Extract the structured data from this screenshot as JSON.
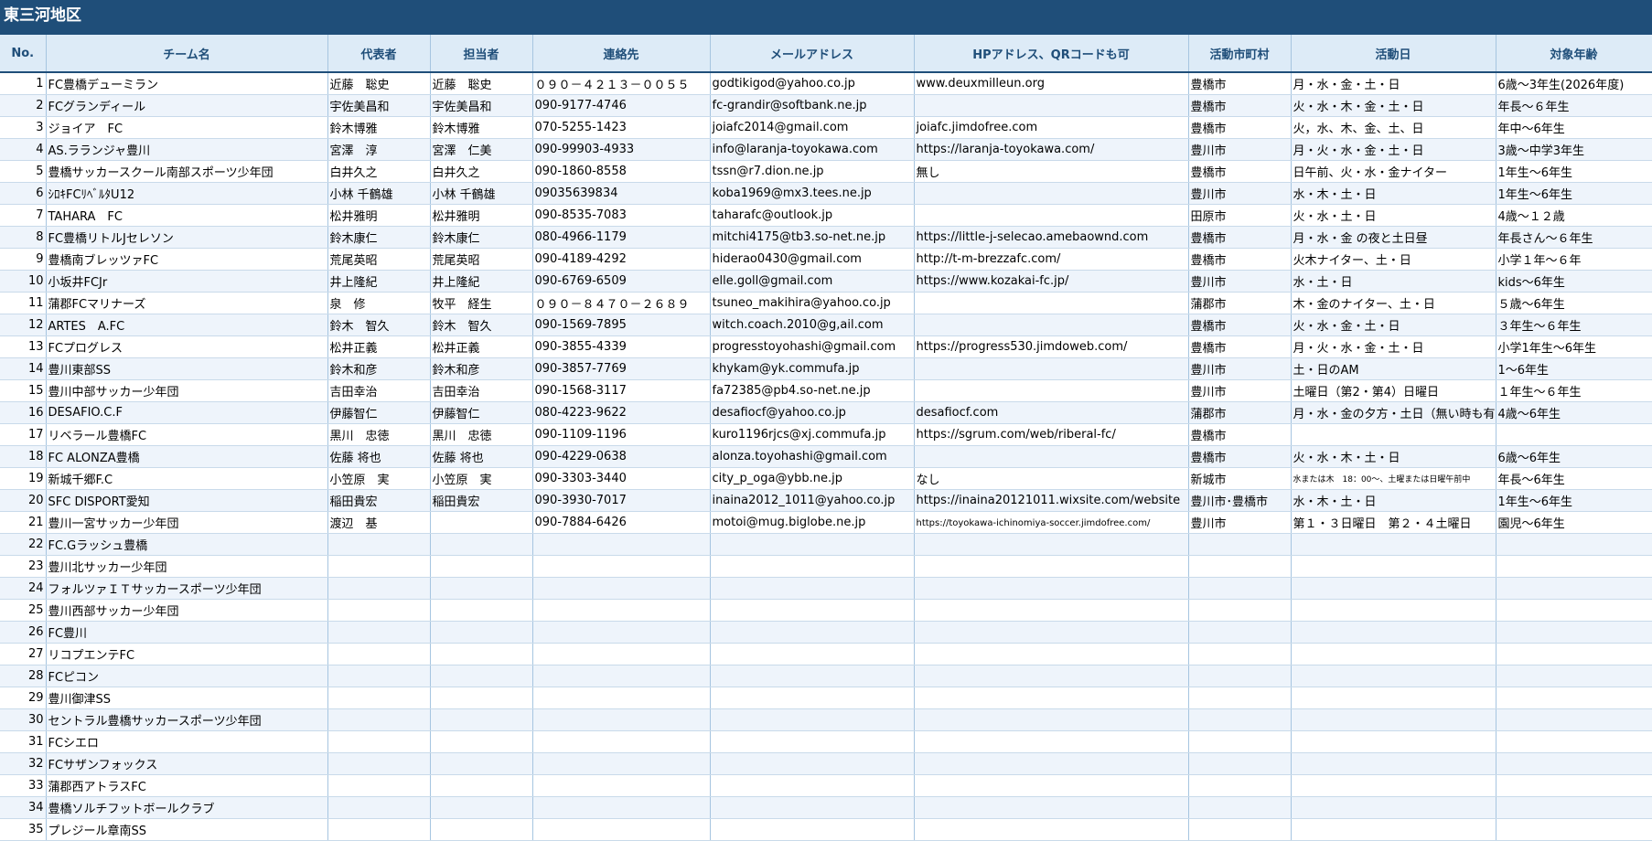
{
  "sheet_title": "東三河地区",
  "accent_color": "#1f4e79",
  "header_fill": "#ddebf7",
  "columns": [
    {
      "key": "no",
      "label": "No."
    },
    {
      "key": "team",
      "label": "チーム名"
    },
    {
      "key": "rep",
      "label": "代表者"
    },
    {
      "key": "contact_person",
      "label": "担当者"
    },
    {
      "key": "phone",
      "label": "連絡先"
    },
    {
      "key": "email",
      "label": "メールアドレス"
    },
    {
      "key": "hp",
      "label": "HPアドレス、QRコードも可"
    },
    {
      "key": "city",
      "label": "活動市町村"
    },
    {
      "key": "days",
      "label": "活動日"
    },
    {
      "key": "age",
      "label": "対象年齢"
    }
  ],
  "rows": [
    {
      "no": "1",
      "team": "FC豊橋デューミラン",
      "rep": "近藤　聡史",
      "contact_person": "近藤　聡史",
      "phone": "０９０－４２１３－００５５",
      "email": "godtikigod@yahoo.co.jp",
      "email_link": true,
      "hp": "www.deuxmilleun.org",
      "hp_link": true,
      "city": "豊橋市",
      "days": "月・水・金・土・日",
      "age": "6歳～3年生(2026年度)"
    },
    {
      "no": "2",
      "team": "FCグランディール",
      "rep": "宇佐美昌和",
      "contact_person": "宇佐美昌和",
      "phone": "090-9177-4746",
      "email": "fc-grandir@softbank.ne.jp",
      "email_link": true,
      "hp": "",
      "city": "豊橋市",
      "days": "火・水・木・金・土・日",
      "age": "年長～６年生"
    },
    {
      "no": "3",
      "team": "ジョイア　FC",
      "rep": "鈴木博雅",
      "contact_person": "鈴木博雅",
      "phone": "070-5255-1423",
      "email": "joiafc2014@gmail.com",
      "email_link": true,
      "hp": "joiafc.jimdofree.com",
      "hp_link": true,
      "city": "豊橋市",
      "days": "火，水、木、金、土、日",
      "age": "年中～6年生"
    },
    {
      "no": "4",
      "team": "AS.ラランジャ豊川",
      "rep": "宮澤　淳",
      "contact_person": "宮澤　仁美",
      "phone": "090-99903-4933",
      "phone_link": true,
      "email": "info@laranja-toyokawa.com",
      "email_link": true,
      "hp": "https://laranja-toyokawa.com/",
      "hp_link": true,
      "city": "豊川市",
      "days": "月・火・水・金・土・日",
      "age": "3歳～中学3年生"
    },
    {
      "no": "5",
      "team": "豊橋サッカースクール南部スポーツ少年団",
      "rep": "白井久之",
      "contact_person": "白井久之",
      "phone": "090-1860-8558",
      "email": "tssn@r7.dion.ne.jp",
      "email_link": true,
      "hp": "無し",
      "hp_link": true,
      "city": "豊橋市",
      "days": "日午前、火・水・金ナイター",
      "age": "1年生～6年生"
    },
    {
      "no": "6",
      "team": "ｼﾛｷFCﾘﾍﾞﾙﾀU12",
      "rep": "小林 千鶴雄",
      "contact_person": "小林 千鶴雄",
      "phone": "09035639834",
      "email": "koba1969@mx3.tees.ne.jp",
      "email_link": true,
      "hp": "",
      "city": "豊川市",
      "days": "水・木・土・日",
      "age": "1年生～6年生"
    },
    {
      "no": "7",
      "team": "TAHARA　FC",
      "rep": "松井雅明",
      "contact_person": "松井雅明",
      "phone": "090-8535-7083",
      "email": "taharafc@outlook.jp",
      "email_link": true,
      "hp": "",
      "city": "田原市",
      "days": "火・水・土・日",
      "age": "4歳～１２歳"
    },
    {
      "no": "8",
      "team": "FC豊橋リトルJセレソン",
      "rep": "鈴木康仁",
      "contact_person": "鈴木康仁",
      "phone": "080-4966-1179",
      "email": "mitchi4175@tb3.so-net.ne.jp",
      "email_link": true,
      "hp": "https://little-j-selecao.amebaownd.com",
      "hp_link": true,
      "city": "豊橋市",
      "days": "月・水・金 の夜と土日昼",
      "age": "年長さん～６年生"
    },
    {
      "no": "9",
      "team": "豊橋南ブレッツァFC",
      "rep": "荒尾英昭",
      "contact_person": "荒尾英昭",
      "phone": "090-4189-4292",
      "email": "hiderao0430@gmail.com",
      "email_link": true,
      "hp": "http://t-m-brezzafc.com/",
      "hp_link": true,
      "city": "豊橋市",
      "days": "火木ナイター、土・日",
      "age": "小学１年～６年"
    },
    {
      "no": "10",
      "team": "小坂井FCJr",
      "rep": "井上隆紀",
      "contact_person": "井上隆紀",
      "phone": "090-6769-6509",
      "email": "elle.goll@gmail.com",
      "email_link": false,
      "hp": "https://www.kozakai-fc.jp/",
      "hp_link": true,
      "city": "豊川市",
      "days": "水・土・日",
      "age": "kids～6年生"
    },
    {
      "no": "11",
      "team": "蒲郡FCマリナーズ",
      "rep": "泉　修",
      "contact_person": "牧平　経生",
      "phone": "０９０－８４７０－２６８９",
      "email": "tsuneo_makihira@yahoo.co.jp",
      "email_link": false,
      "hp": "",
      "city": "蒲郡市",
      "days": "木・金のナイター、土・日",
      "age": "５歳～6年生"
    },
    {
      "no": "12",
      "team": "ARTES　A.FC",
      "rep": "鈴木　智久",
      "contact_person": "鈴木　智久",
      "phone": "090-1569-7895",
      "email": "witch.coach.2010@g,ail.com",
      "email_link": true,
      "hp": "",
      "city": "豊橋市",
      "days": "火・水・金・土・日",
      "age": "３年生～６年生"
    },
    {
      "no": "13",
      "team": "FCプログレス",
      "rep": "松井正義",
      "contact_person": "松井正義",
      "phone": "090-3855-4339",
      "email": "progresstoyohashi@gmail.com",
      "email_link": true,
      "hp": "https://progress530.jimdoweb.com/",
      "hp_link": true,
      "city": "豊橋市",
      "days": "月・火・水・金・土・日",
      "age": "小学1年生～6年生"
    },
    {
      "no": "14",
      "team": "豊川東部SS",
      "rep": "鈴木和彦",
      "contact_person": "鈴木和彦",
      "phone": "090-3857-7769",
      "email": "khykam@yk.commufa.jp",
      "email_link": true,
      "hp": "",
      "city": "豊川市",
      "days": "土・日のAM",
      "age": "1～6年生"
    },
    {
      "no": "15",
      "team": "豊川中部サッカー少年団",
      "rep": "吉田幸治",
      "contact_person": "吉田幸治",
      "phone": "090-1568-3117",
      "email": "fa72385@pb4.so-net.ne.jp",
      "email_link": true,
      "hp": "",
      "city": "豊川市",
      "days": "土曜日（第2・第4）日曜日",
      "age": "１年生～６年生"
    },
    {
      "no": "16",
      "team": "DESAFIO.C.F",
      "rep": "伊藤智仁",
      "contact_person": "伊藤智仁",
      "phone": "080-4223-9622",
      "email": "desafiocf@yahoo.co.jp",
      "email_link": true,
      "hp": "desafiocf.com",
      "hp_link": true,
      "city": "蒲郡市",
      "days": "月・水・金の夕方・土日（無い時も有）",
      "age": "4歳～6年生"
    },
    {
      "no": "17",
      "team": "リベラール豊橋FC",
      "rep": "黒川　忠徳",
      "contact_person": "黒川　忠徳",
      "phone": "090-1109-1196",
      "email": "kuro1196rjcs@xj.commufa.jp",
      "email_link": false,
      "hp": "https://sgrum.com/web/riberal-fc/",
      "hp_link": false,
      "city": "豊橋市",
      "days": "",
      "age": ""
    },
    {
      "no": "18",
      "team": "FC ALONZA豊橋",
      "rep": "佐藤 将也",
      "contact_person": "佐藤 将也",
      "phone": "090-4229-0638",
      "email": "alonza.toyohashi@gmail.com",
      "email_link": true,
      "hp": "",
      "city": "豊橋市",
      "days": "火・水・木・土・日",
      "age": "6歳～6年生"
    },
    {
      "no": "19",
      "team": "新城千郷F.C",
      "rep": "小笠原　実",
      "contact_person": "小笠原　実",
      "phone": "090-3303-3440",
      "email": "city_p_oga@ybb.ne.jp",
      "email_link": true,
      "hp": "なし",
      "hp_link": false,
      "city": "新城市",
      "days": "水または木　18：00～、土曜または日曜午前中",
      "days_small": true,
      "age": "年長～6年生"
    },
    {
      "no": "20",
      "team": "SFC DISPORT愛知",
      "rep": "稲田貴宏",
      "contact_person": "稲田貴宏",
      "phone": "090-3930-7017",
      "email": "inaina2012_1011@yahoo.co.jp",
      "email_link": true,
      "hp": "https://inaina20121011.wixsite.com/website",
      "hp_link": true,
      "city": "豊川市･豊橋市",
      "days": "水・木・土・日",
      "age": "1年生～6年生"
    },
    {
      "no": "21",
      "team": "豊川一宮サッカー少年団",
      "rep": "渡辺　基",
      "contact_person": "",
      "phone": "090-7884-6426",
      "email": "motoi@mug.biglobe.ne.jp",
      "email_link": false,
      "hp": "https://toyokawa-ichinomiya-soccer.jimdofree.com/",
      "hp_link": true,
      "hp_small": true,
      "city": "豊川市",
      "days": "第１・３日曜日　第２・４土曜日",
      "age": "園児～6年生"
    },
    {
      "no": "22",
      "team": "FC.Gラッシュ豊橋"
    },
    {
      "no": "23",
      "team": "豊川北サッカー少年団"
    },
    {
      "no": "24",
      "team": "フォルツァＩＴサッカースポーツ少年団"
    },
    {
      "no": "25",
      "team": "豊川西部サッカー少年団"
    },
    {
      "no": "26",
      "team": "FC豊川"
    },
    {
      "no": "27",
      "team": "リコプエンテFC"
    },
    {
      "no": "28",
      "team": "FCピコン"
    },
    {
      "no": "29",
      "team": "豊川御津SS"
    },
    {
      "no": "30",
      "team": "セントラル豊橋サッカースポーツ少年団"
    },
    {
      "no": "31",
      "team": "FCシエロ"
    },
    {
      "no": "32",
      "team": "FCサザンフォックス"
    },
    {
      "no": "33",
      "team": "蒲郡西アトラスFC"
    },
    {
      "no": "34",
      "team": "豊橋ソルチフットボールクラブ"
    },
    {
      "no": "35",
      "team": "プレジール章南SS"
    }
  ]
}
